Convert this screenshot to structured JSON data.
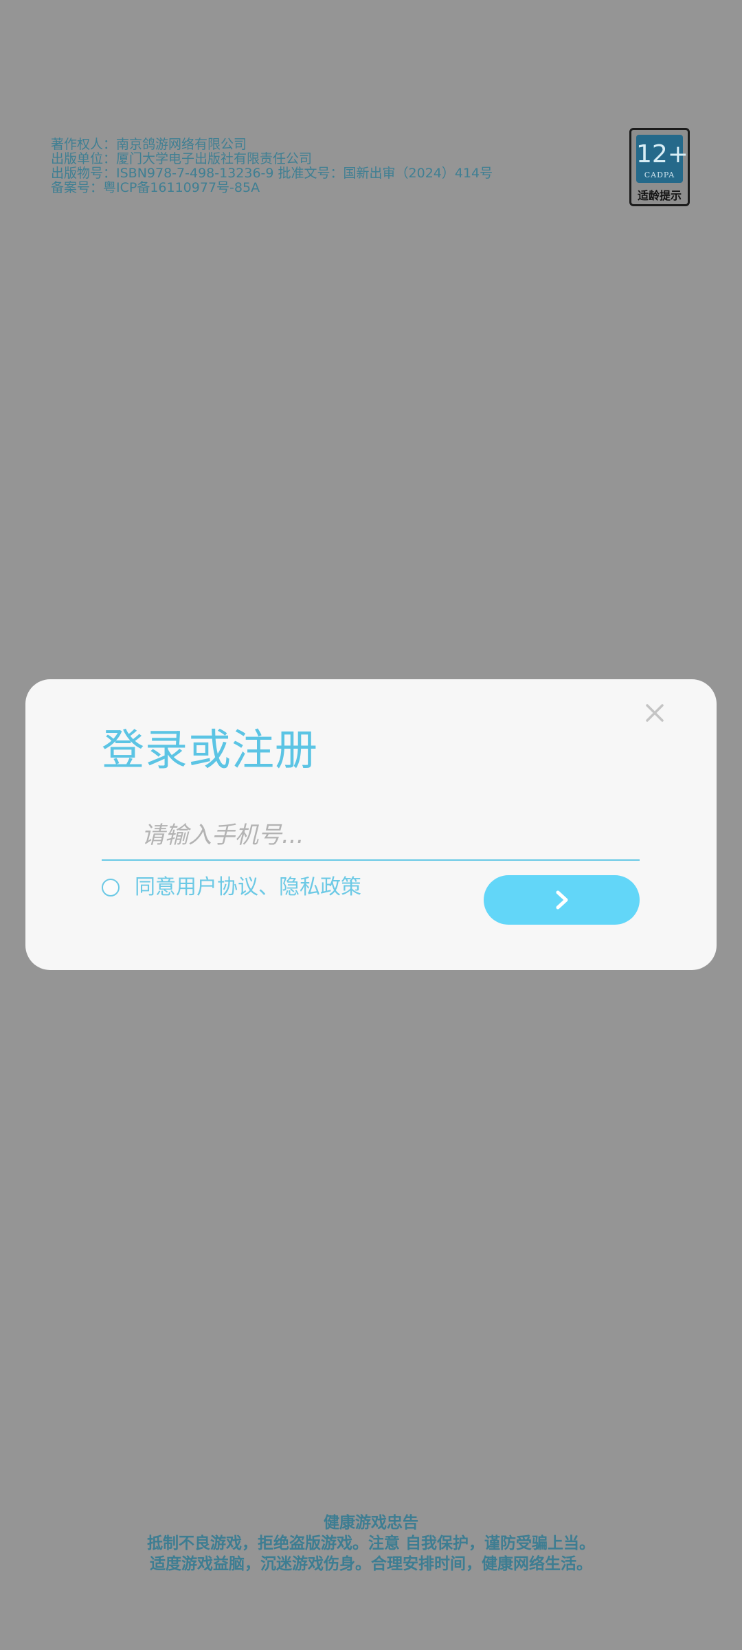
{
  "copyright": {
    "lines": [
      "著作权人：南京鸽游网络有限公司",
      "出版单位：厦门大学电子出版社有限责任公司",
      "出版物号：ISBN978-7-498-13236-9 批准文号：国新出审（2024）414号",
      "备案号：粤ICP备16110977号-85A"
    ]
  },
  "age_badge": {
    "age": "12+",
    "org": "CADPA",
    "tip": "适龄提示",
    "accent": "#25698a"
  },
  "login_dialog": {
    "title": "登录或注册",
    "phone_placeholder": "请输入手机号...",
    "agree_label": "同意用户协议、隐私政策",
    "close_icon": "close-icon",
    "next_icon": "chevron-right-icon",
    "accent": "#5bc4e4",
    "button_color": "#62d6f8"
  },
  "health_notice": {
    "title": "健康游戏忠告",
    "line1": "抵制不良游戏，拒绝盗版游戏。注意 自我保护，谨防受骗上当。",
    "line2": "适度游戏益脑，沉迷游戏伤身。合理安排时间，健康网络生活。"
  }
}
